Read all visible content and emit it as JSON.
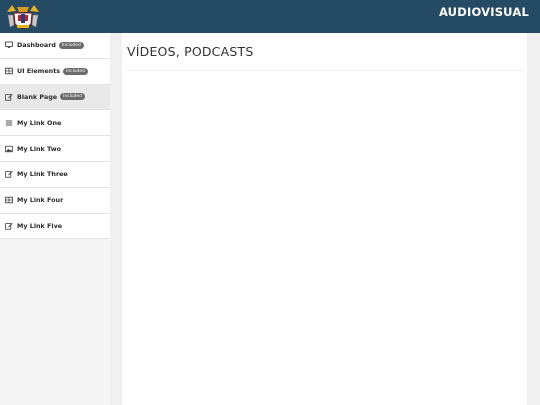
{
  "header": {
    "brand": "AUDIOVISUAL",
    "bg_color": "#254a64"
  },
  "sidebar": {
    "items": [
      {
        "label": "Dashboard",
        "badge": "Included",
        "icon": "monitor-icon"
      },
      {
        "label": "UI Elements",
        "badge": "Included",
        "icon": "table-icon"
      },
      {
        "label": "Blank Page",
        "badge": "Included",
        "icon": "edit-icon",
        "active": true
      },
      {
        "label": "My Link One",
        "badge": "",
        "icon": "list-icon"
      },
      {
        "label": "My Link Two",
        "badge": "",
        "icon": "image-icon"
      },
      {
        "label": "My Link Three",
        "badge": "",
        "icon": "edit-icon"
      },
      {
        "label": "My Link Four",
        "badge": "",
        "icon": "table-icon"
      },
      {
        "label": "My Link Five",
        "badge": "",
        "icon": "edit-icon"
      }
    ]
  },
  "main": {
    "title": "VÍDEOS, PODCASTS"
  }
}
